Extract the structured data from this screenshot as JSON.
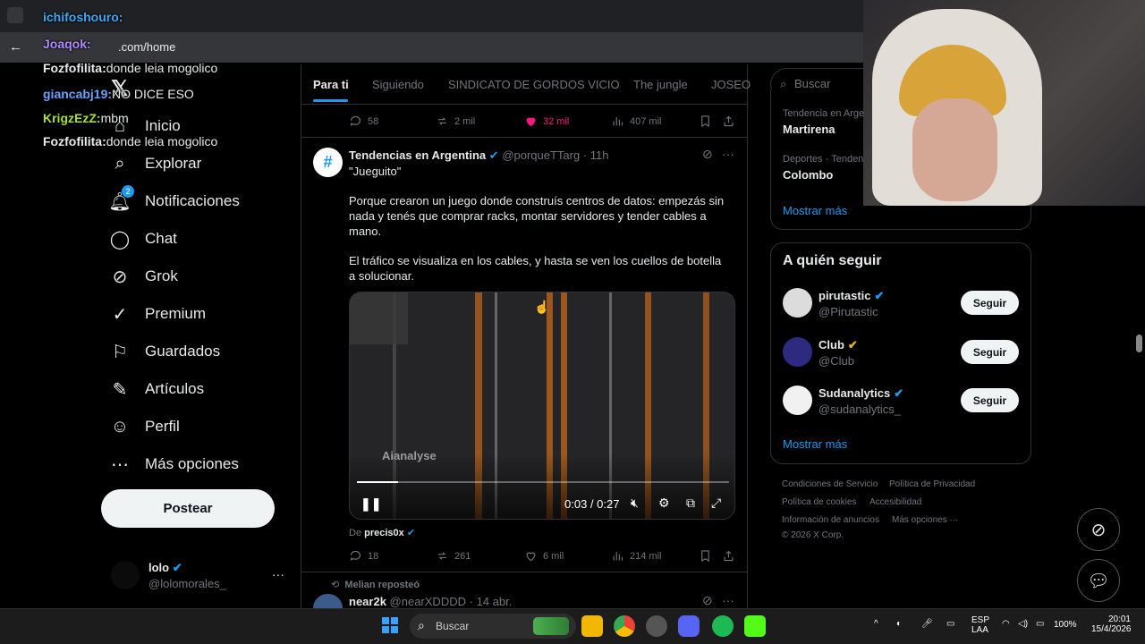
{
  "browser": {
    "url": ".com/home"
  },
  "chat": [
    {
      "user": "ichifoshouro:",
      "msg": "",
      "color": "#3fa9f5"
    },
    {
      "user": "Joaqok:",
      "msg": "",
      "color": "#b08cff"
    },
    {
      "user": "Fozfofilita:",
      "msg": "donde leia mogolico",
      "color": "#e7e9ea"
    },
    {
      "user": "giancabj19:",
      "msg": "NO DICE ESO",
      "color": "#6aa0ff"
    },
    {
      "user": "KrigzEzZ:",
      "msg": "mbm",
      "color": "#a6e22e"
    },
    {
      "user": "Fozfofilita:",
      "msg": "donde leia mogolico",
      "color": "#e7e9ea"
    }
  ],
  "nav": {
    "items": [
      {
        "label": "Inicio",
        "icon": "home-icon"
      },
      {
        "label": "Explorar",
        "icon": "search-icon"
      },
      {
        "label": "Notificaciones",
        "icon": "bell-icon",
        "badge": "2"
      },
      {
        "label": "Chat",
        "icon": "chat-icon"
      },
      {
        "label": "Grok",
        "icon": "grok-icon"
      },
      {
        "label": "Premium",
        "icon": "premium-icon"
      },
      {
        "label": "Guardados",
        "icon": "bookmark-icon"
      },
      {
        "label": "Artículos",
        "icon": "article-icon"
      },
      {
        "label": "Perfil",
        "icon": "profile-icon"
      },
      {
        "label": "Más opciones",
        "icon": "more-icon"
      }
    ],
    "post_label": "Postear"
  },
  "account": {
    "name": "lolo",
    "handle": "@lolomorales_"
  },
  "tabs": [
    "Para ti",
    "Siguiendo",
    "SINDICATO DE GORDOS VICIO",
    "The jungle",
    "JOSEO"
  ],
  "prev_post": {
    "replies": "58",
    "reposts": "2 mil",
    "likes": "32 mil",
    "views": "407 mil"
  },
  "post": {
    "author": "Tendencias en Argentina",
    "handle": "@porqueTTarg",
    "time": "· 11h",
    "p1": "\"Jueguito\"",
    "p2": "Porque crearon un juego donde construís centros de datos: empezás sin nada y tenés que comprar racks, montar servidores y tender cables a mano.",
    "p3": "El tráfico se visualiza en los cables, y hasta se ven los cuellos de botella a solucionar.",
    "video": {
      "watermark": "Aianalyse",
      "time": "0:03 / 0:27",
      "progress": 0.11
    },
    "from_label": "De",
    "from_user": "precis0x",
    "replies": "18",
    "reposts": "261",
    "likes": "6 mil",
    "views": "214 mil"
  },
  "next_post": {
    "reposted_by": "Melian reposteó",
    "author": "near2k",
    "handle": "@nearXDDDD",
    "time": "· 14 abr."
  },
  "search": {
    "placeholder": "Buscar"
  },
  "trends": [
    {
      "meta": "Tendencia en Arge",
      "name": "Martirena"
    },
    {
      "meta": "Deportes · Tenden",
      "name": "Colombo"
    }
  ],
  "trends_more": "Mostrar más",
  "follow": {
    "title": "A quién seguir",
    "users": [
      {
        "name": "pirutastic",
        "handle": "@Pirutastic",
        "badge": "blue"
      },
      {
        "name": "Club",
        "handle": "@Club",
        "badge": "gold"
      },
      {
        "name": "Sudanalytics",
        "handle": "@sudanalytics_",
        "badge": "blue"
      }
    ],
    "button": "Seguir",
    "more": "Mostrar más"
  },
  "footer": {
    "links": [
      "Condiciones de Servicio",
      "Política de Privacidad",
      "Política de cookies",
      "Accesibilidad",
      "Información de anuncios",
      "Más opciones ···"
    ],
    "copyright": "© 2026 X Corp."
  },
  "taskbar": {
    "search": "Buscar",
    "lang": "ESP",
    "lang2": "LAA",
    "battery": "100%",
    "time": "20:01",
    "date": "15/4/2026"
  }
}
